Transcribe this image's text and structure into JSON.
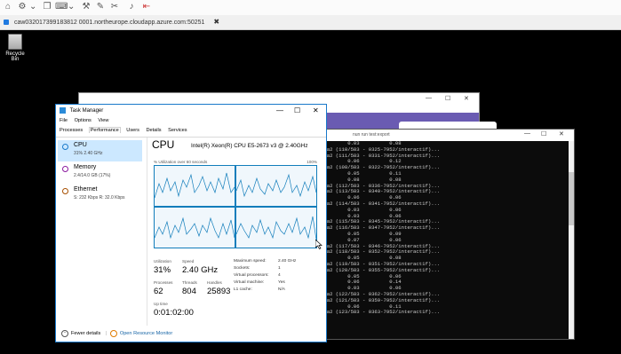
{
  "toolbar": {
    "icons": [
      "home-icon",
      "gear-icon",
      "chevron-down-icon",
      "copy-icon",
      "keyboard-icon",
      "chevron-down-icon",
      "wrench-icon",
      "pen-icon",
      "tools-icon",
      "speaker-icon",
      "exit-icon"
    ]
  },
  "tab": {
    "address": "caw032017399183812 0001.northeurope.cloudapp.azure.com:50251",
    "close": "✖"
  },
  "desktop": {
    "recycle_label": "Recycle Bin"
  },
  "browser": {
    "minimize": "—",
    "maximize": "☐",
    "close": "✕"
  },
  "console": {
    "title": "nun run test:export",
    "lines": [
      "         0.03          0.08",
      "eta2 (110/583 - 0325-7952/interact1f)...",
      "eta2 (111/583 - 0331-7952/interact1f)...",
      "         0.06          0.12",
      "eta2 (108/583 - 0322-7952/interact1f)...",
      "         0.05          0.11",
      "         0.08          0.08",
      "eta2 (112/583 - 0336-7952/interact1f)...",
      "eta2 (113/583 - 0340-7952/interact1f)...",
      "         0.06          0.06",
      "eta2 (114/583 - 0341-7952/interact1f)...",
      "         0.03          0.06",
      "         0.03          0.06",
      "eta2 (115/583 - 0345-7952/interact1f)...",
      "eta2 (116/583 - 0347-7952/interact1f)...",
      "         0.05          0.09",
      "         0.07          0.06",
      "eta2 (117/583 - 0346-7952/interact1f)...",
      "eta2 (118/583 - 0352-7952/interact1f)...",
      "         0.05          0.08",
      "eta2 (119/583 - 0351-7952/interact1f)...",
      "eta2 (120/583 - 0355-7952/interact1f)...",
      "         0.05          0.06",
      "         0.06          0.14",
      "         0.03          0.06",
      "eta2 (122/583 - 0362-7952/interact1f)...",
      "eta2 (121/583 - 0359-7952/interact1f)...",
      "         0.06          0.11",
      "eta2 (123/583 - 0363-7952/interact1f)..."
    ]
  },
  "taskmanager": {
    "title": "Task Manager",
    "menu": [
      "File",
      "Options",
      "View"
    ],
    "tabs": [
      "Processes",
      "Performance",
      "Users",
      "Details",
      "Services"
    ],
    "active_tab": "Performance",
    "sidebar": [
      {
        "name": "CPU",
        "sub": "31% 2.40 GHz",
        "color": "#1979ca"
      },
      {
        "name": "Memory",
        "sub": "2.4/14.0 GB (17%)",
        "color": "#8b1a9f"
      },
      {
        "name": "Ethernet",
        "sub": "S: 232 Kbps R: 32.0 Kbps",
        "color": "#a74f01"
      }
    ],
    "cpu": {
      "title": "CPU",
      "model": "Intel(R) Xeon(R) CPU E5-2673 v3 @ 2.40GHz",
      "util_label": "% Utilization over 60 seconds",
      "util_max": "100%",
      "utilization_label": "Utilization",
      "utilization": "31%",
      "speed_label": "Speed",
      "speed": "2.40 GHz",
      "processes_label": "Processes",
      "processes": "62",
      "threads_label": "Threads",
      "threads": "804",
      "handles_label": "Handles",
      "handles": "25893",
      "uptime_label": "Up time",
      "uptime": "0:01:02:00",
      "specs": [
        {
          "k": "Maximum speed:",
          "v": "2.40 GHz"
        },
        {
          "k": "Sockets:",
          "v": "1"
        },
        {
          "k": "Virtual processors:",
          "v": "4"
        },
        {
          "k": "Virtual machine:",
          "v": "Yes"
        },
        {
          "k": "L1 cache:",
          "v": "N/A"
        }
      ]
    },
    "footer": {
      "fewer": "Fewer details",
      "monitor": "Open Resource Monitor"
    }
  }
}
